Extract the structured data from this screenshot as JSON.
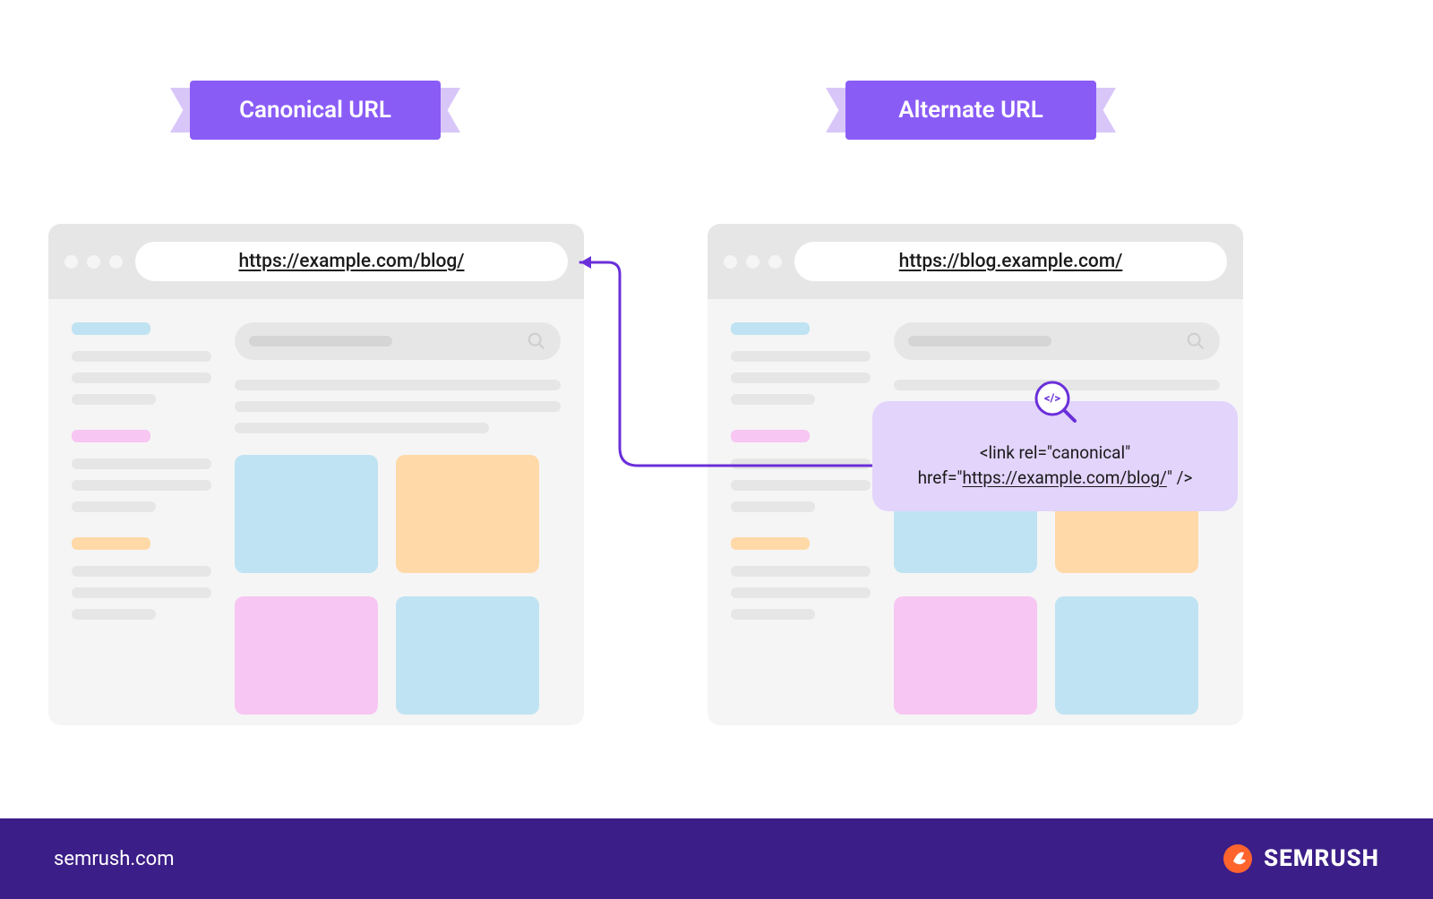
{
  "labels": {
    "canonical": "Canonical URL",
    "alternate": "Alternate URL"
  },
  "urls": {
    "canonical": "https://example.com/blog/",
    "alternate": "https://blog.example.com/"
  },
  "code": {
    "line1": "<link rel=\"canonical\"",
    "line2_prefix": "href=\"",
    "line2_url": "https://example.com/blog/",
    "line2_suffix": "\" />"
  },
  "footer": {
    "domain": "semrush.com",
    "brand": "SEMRUSH"
  }
}
